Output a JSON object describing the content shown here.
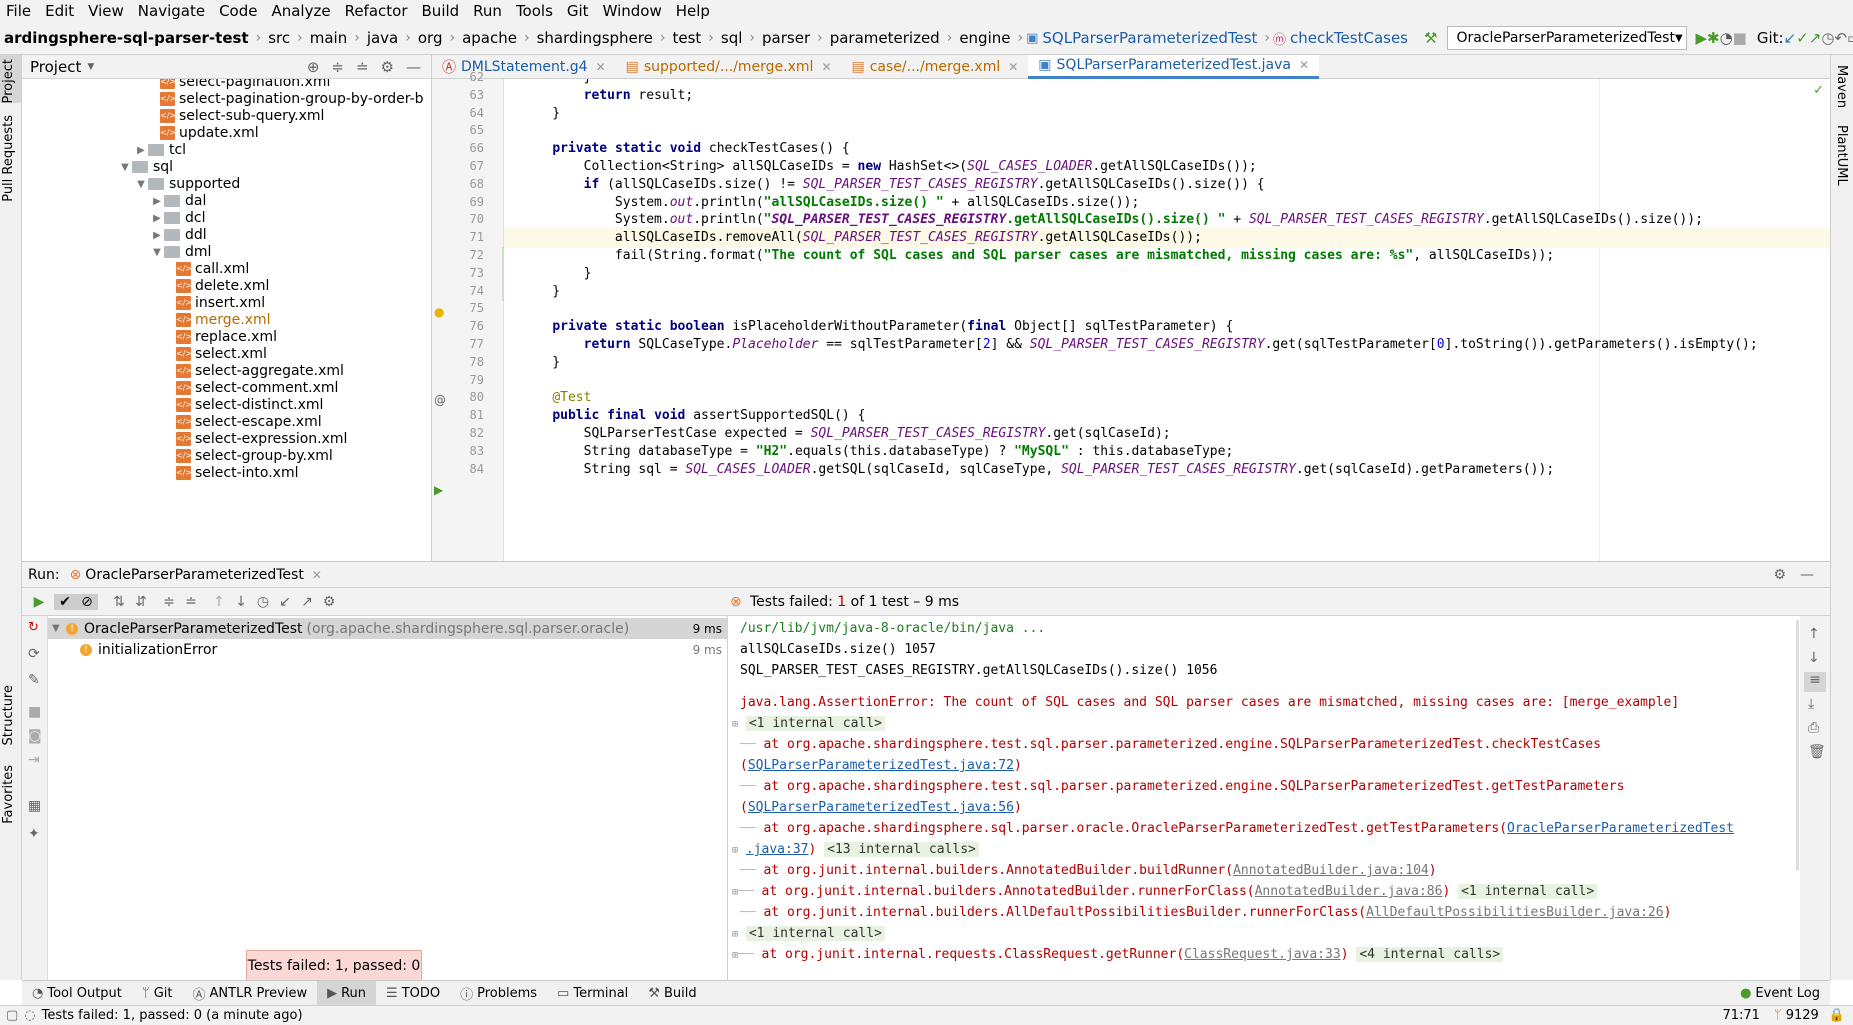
{
  "menu": [
    "File",
    "Edit",
    "View",
    "Navigate",
    "Code",
    "Analyze",
    "Refactor",
    "Build",
    "Run",
    "Tools",
    "Git",
    "Window",
    "Help"
  ],
  "breadcrumbs": [
    "ardingsphere-sql-parser-test",
    "src",
    "main",
    "java",
    "org",
    "apache",
    "shardingsphere",
    "test",
    "sql",
    "parser",
    "parameterized",
    "engine"
  ],
  "breadcrumb_class": "SQLParserParameterizedTest",
  "breadcrumb_method": "checkTestCases",
  "run_config": "OracleParserParameterizedTest",
  "git_label": "Git:",
  "project": {
    "title": "Project",
    "rows": [
      {
        "type": "file",
        "name": "select-pagination.xml",
        "indent": 2
      },
      {
        "type": "file",
        "name": "select-pagination-group-by-order-b",
        "indent": 2
      },
      {
        "type": "file",
        "name": "select-sub-query.xml",
        "indent": 2
      },
      {
        "type": "file",
        "name": "update.xml",
        "indent": 2
      },
      {
        "type": "folder",
        "name": "tcl",
        "indent": 1,
        "arrow": "right"
      },
      {
        "type": "folder",
        "name": "sql",
        "indent": 0,
        "arrow": "down"
      },
      {
        "type": "folder",
        "name": "supported",
        "indent": 1,
        "arrow": "down"
      },
      {
        "type": "folder",
        "name": "dal",
        "indent": 2,
        "arrow": "right"
      },
      {
        "type": "folder",
        "name": "dcl",
        "indent": 2,
        "arrow": "right"
      },
      {
        "type": "folder",
        "name": "ddl",
        "indent": 2,
        "arrow": "right"
      },
      {
        "type": "folder",
        "name": "dml",
        "indent": 2,
        "arrow": "down"
      },
      {
        "type": "file",
        "name": "call.xml",
        "indent": 3
      },
      {
        "type": "file",
        "name": "delete.xml",
        "indent": 3
      },
      {
        "type": "file",
        "name": "insert.xml",
        "indent": 3
      },
      {
        "type": "file",
        "name": "merge.xml",
        "indent": 3,
        "modified": true
      },
      {
        "type": "file",
        "name": "replace.xml",
        "indent": 3
      },
      {
        "type": "file",
        "name": "select.xml",
        "indent": 3
      },
      {
        "type": "file",
        "name": "select-aggregate.xml",
        "indent": 3
      },
      {
        "type": "file",
        "name": "select-comment.xml",
        "indent": 3
      },
      {
        "type": "file",
        "name": "select-distinct.xml",
        "indent": 3
      },
      {
        "type": "file",
        "name": "select-escape.xml",
        "indent": 3
      },
      {
        "type": "file",
        "name": "select-expression.xml",
        "indent": 3
      },
      {
        "type": "file",
        "name": "select-group-by.xml",
        "indent": 3
      },
      {
        "type": "file",
        "name": "select-into.xml",
        "indent": 3
      }
    ]
  },
  "editor_tabs": [
    {
      "label": "DMLStatement.g4",
      "color": "blue"
    },
    {
      "label": "supported/.../merge.xml",
      "color": "orange"
    },
    {
      "label": "case/.../merge.xml",
      "color": "orange"
    },
    {
      "label": "SQLParserParameterizedTest.java",
      "color": "blue",
      "active": true
    }
  ],
  "code_lines": [
    {
      "n": "62",
      "t": "        }"
    },
    {
      "n": "63",
      "t": "        return result;"
    },
    {
      "n": "64",
      "t": "    }"
    },
    {
      "n": "65",
      "t": ""
    },
    {
      "n": "66",
      "t": "    private static void checkTestCases() {"
    },
    {
      "n": "67",
      "t": "        Collection<String> allSQLCaseIDs = new HashSet<>(SQL_CASES_LOADER.getAllSQLCaseIDs());"
    },
    {
      "n": "68",
      "t": "        if (allSQLCaseIDs.size() != SQL_PARSER_TEST_CASES_REGISTRY.getAllSQLCaseIDs().size()) {"
    },
    {
      "n": "69",
      "t": "            System.out.println(\"allSQLCaseIDs.size() \" + allSQLCaseIDs.size());"
    },
    {
      "n": "70",
      "t": "            System.out.println(\"SQL_PARSER_TEST_CASES_REGISTRY.getAllSQLCaseIDs().size() \" + SQL_PARSER_TEST_CASES_REGISTRY.getAllSQLCaseIDs().size());"
    },
    {
      "n": "71",
      "t": "            allSQLCaseIDs.removeAll(SQL_PARSER_TEST_CASES_REGISTRY.getAllSQLCaseIDs());"
    },
    {
      "n": "72",
      "t": "            fail(String.format(\"The count of SQL cases and SQL parser cases are mismatched, missing cases are: %s\", allSQLCaseIDs));"
    },
    {
      "n": "73",
      "t": "        }"
    },
    {
      "n": "74",
      "t": "    }"
    },
    {
      "n": "75",
      "t": ""
    },
    {
      "n": "76",
      "t": "    private static boolean isPlaceholderWithoutParameter(final Object[] sqlTestParameter) {"
    },
    {
      "n": "77",
      "t": "        return SQLCaseType.Placeholder == sqlTestParameter[2] && SQL_PARSER_TEST_CASES_REGISTRY.get(sqlTestParameter[0].toString()).getParameters().isEmpty();"
    },
    {
      "n": "78",
      "t": "    }"
    },
    {
      "n": "79",
      "t": ""
    },
    {
      "n": "80",
      "t": "    @Test"
    },
    {
      "n": "81",
      "t": "    public final void assertSupportedSQL() {"
    },
    {
      "n": "82",
      "t": "        SQLParserTestCase expected = SQL_PARSER_TEST_CASES_REGISTRY.get(sqlCaseId);"
    },
    {
      "n": "83",
      "t": "        String databaseType = \"H2\".equals(this.databaseType) ? \"MySQL\" : this.databaseType;"
    },
    {
      "n": "84",
      "t": "        String sql = SQL_CASES_LOADER.getSQL(sqlCaseId, sqlCaseType, SQL_PARSER_TEST_CASES_REGISTRY.get(sqlCaseId).getParameters());"
    }
  ],
  "run": {
    "label": "Run:",
    "tab": "OracleParserParameterizedTest",
    "status_prefix": "Tests failed:",
    "status_count": "1",
    "status_suffix": "of 1 test – 9 ms",
    "tree": [
      {
        "name": "OracleParserParameterizedTest",
        "pkg": "(org.apache.shardingsphere.sql.parser.oracle)",
        "time": "9 ms"
      },
      {
        "name": "initializationError",
        "pkg": "",
        "time": "9 ms"
      }
    ]
  },
  "console": {
    "l1": "/usr/lib/jvm/java-8-oracle/bin/java ...",
    "l2": "allSQLCaseIDs.size() 1057",
    "l3": "SQL_PARSER_TEST_CASES_REGISTRY.getAllSQLCaseIDs().size() 1056",
    "l4": "java.lang.AssertionError: The count of SQL cases and SQL parser cases are mismatched, missing cases are: [merge_example]",
    "l5": "<1 internal call>",
    "l6a": "at org.apache.shardingsphere.test.sql.parser.parameterized.engine.SQLParserParameterizedTest.checkTestCases",
    "l6b": "SQLParserParameterizedTest.java:72",
    "l7a": "at org.apache.shardingsphere.test.sql.parser.parameterized.engine.SQLParserParameterizedTest.getTestParameters",
    "l7b": "SQLParserParameterizedTest.java:56",
    "l8a": "at org.apache.shardingsphere.sql.parser.oracle.OracleParserParameterizedTest.getTestParameters(",
    "l8b": "OracleParserParameterizedTest",
    "l9a": ".java:37",
    "l9b": "<13 internal calls>",
    "l10a": "at org.junit.internal.builders.AnnotatedBuilder.buildRunner(",
    "l10b": "AnnotatedBuilder.java:104",
    "l11a": "at org.junit.internal.builders.AnnotatedBuilder.runnerForClass(",
    "l11b": "AnnotatedBuilder.java:86",
    "l11c": "<1 internal call>",
    "l12a": "at org.junit.internal.builders.AllDefaultPossibilitiesBuilder.runnerForClass(",
    "l12b": "AllDefaultPossibilitiesBuilder.java:26",
    "l13": "<1 internal call>",
    "l14a": "at org.junit.internal.requests.ClassRequest.getRunner(",
    "l14b": "ClassRequest.java:33",
    "l14c": "<4 internal calls>"
  },
  "popup": "Tests failed: 1, passed: 0",
  "bottom_tabs": [
    "Tool Output",
    "Git",
    "ANTLR Preview",
    "Run",
    "TODO",
    "Problems",
    "Terminal",
    "Build"
  ],
  "event_log": "Event Log",
  "status": {
    "message": "Tests failed: 1, passed: 0 (a minute ago)",
    "position": "71:71",
    "memory": "9129"
  },
  "side_labels": {
    "project": "Project",
    "pull_requests": "Pull Requests",
    "structure": "Structure",
    "favorites": "Favorites",
    "maven": "Maven",
    "plantuml": "PlantUML"
  }
}
